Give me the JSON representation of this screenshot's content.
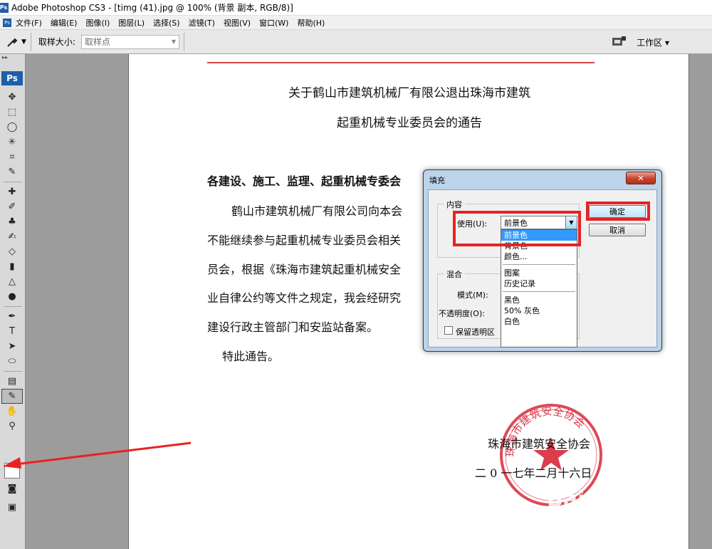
{
  "window": {
    "title": "Adobe Photoshop CS3 - [timg (41).jpg @ 100% (背景 副本, RGB/8)]"
  },
  "menu": [
    "文件(F)",
    "编辑(E)",
    "图像(I)",
    "图层(L)",
    "选择(S)",
    "滤镜(T)",
    "视图(V)",
    "窗口(W)",
    "帮助(H)"
  ],
  "options": {
    "sample_size_label": "取样大小:",
    "sample_value": "取样点",
    "workspace_label": "工作区 ▾"
  },
  "toolbox": {
    "logo": "Ps",
    "active_tool": "eyedropper-tool",
    "swatch_color": "#ffffff"
  },
  "document": {
    "title_line1": "关于鹤山市建筑机械厂有限公退出珠海市建筑",
    "title_line2": "起重机械专业委员会的通告",
    "salutation": "各建设、施工、监理、起重机械专委会",
    "para_line1": "鹤山市建筑机械厂有限公司向本会",
    "para_line2": "不能继续参与起重机械专业委员会相关",
    "para_line3": "员会，根据《珠海市建筑起重机械安全",
    "para_line4": "业自律公约等文件之规定，我会经研究",
    "para_line5": "建设行政主管部门和安监站备案。",
    "notice": "特此通告。",
    "signature_org": "珠海市建筑安全协会",
    "signature_date": "二 0 一七年二月十六日",
    "stamp_text": "珠海市建筑安全协会",
    "stamp_color": "#d8283a"
  },
  "dialog": {
    "title": "填充",
    "close_label": "✕",
    "content_group": "内容",
    "use_label": "使用(U):",
    "use_value": "前景色",
    "options": [
      "前景色",
      "背景色",
      "颜色...",
      "图案",
      "历史记录",
      "黑色",
      "50% 灰色",
      "白色"
    ],
    "selected_option": "前景色",
    "blend_group": "混合",
    "mode_label": "模式(M):",
    "opacity_label": "不透明度(O):",
    "preserve_label": "保留透明区",
    "ok_label": "确定",
    "cancel_label": "取消"
  },
  "watermark": {
    "brand": "Bai du 经验",
    "url": "jingyan.baidu.com"
  },
  "annotation_color": "#e82222"
}
